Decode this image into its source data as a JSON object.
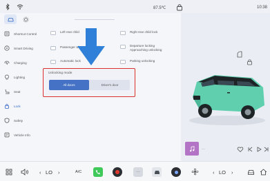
{
  "status": {
    "temperature": "87.5℃",
    "time": "10:38"
  },
  "sidebar": {
    "items": [
      {
        "label": "Shortcut Control",
        "icon": "shortcut-icon"
      },
      {
        "label": "Smart Driving",
        "icon": "steering-wheel-icon"
      },
      {
        "label": "Charging",
        "icon": "charging-icon"
      },
      {
        "label": "Lighting",
        "icon": "bulb-icon"
      },
      {
        "label": "Seat",
        "icon": "seat-icon"
      },
      {
        "label": "Lock",
        "icon": "lock-icon"
      },
      {
        "label": "Safety",
        "icon": "shield-icon"
      },
      {
        "label": "Vehicle Info",
        "icon": "info-icon"
      }
    ],
    "active_index": 5
  },
  "lock_settings": {
    "options": [
      {
        "label": "Left rear child"
      },
      {
        "label": "Right rear child lock"
      },
      {
        "label": "Passenger wi",
        "label_tail": "ld"
      },
      {
        "label": "Departure locking",
        "label2": "Approaching unlocking"
      },
      {
        "label": "Automatic lock"
      },
      {
        "label": "Parking unlocking"
      }
    ],
    "unlocking_mode": {
      "title": "Unlocking mode",
      "choices": [
        "All doors",
        "Driver's door"
      ],
      "selected": "All doors"
    }
  },
  "media": {
    "title": "---"
  },
  "dock": {
    "left_temp": "LO",
    "ac_label": "A/C",
    "right_temp": "LO"
  },
  "colors": {
    "accent": "#4572c4",
    "highlight_box": "#d9302c",
    "car_body": "#5fcfae",
    "arrow": "#2f80d8"
  }
}
